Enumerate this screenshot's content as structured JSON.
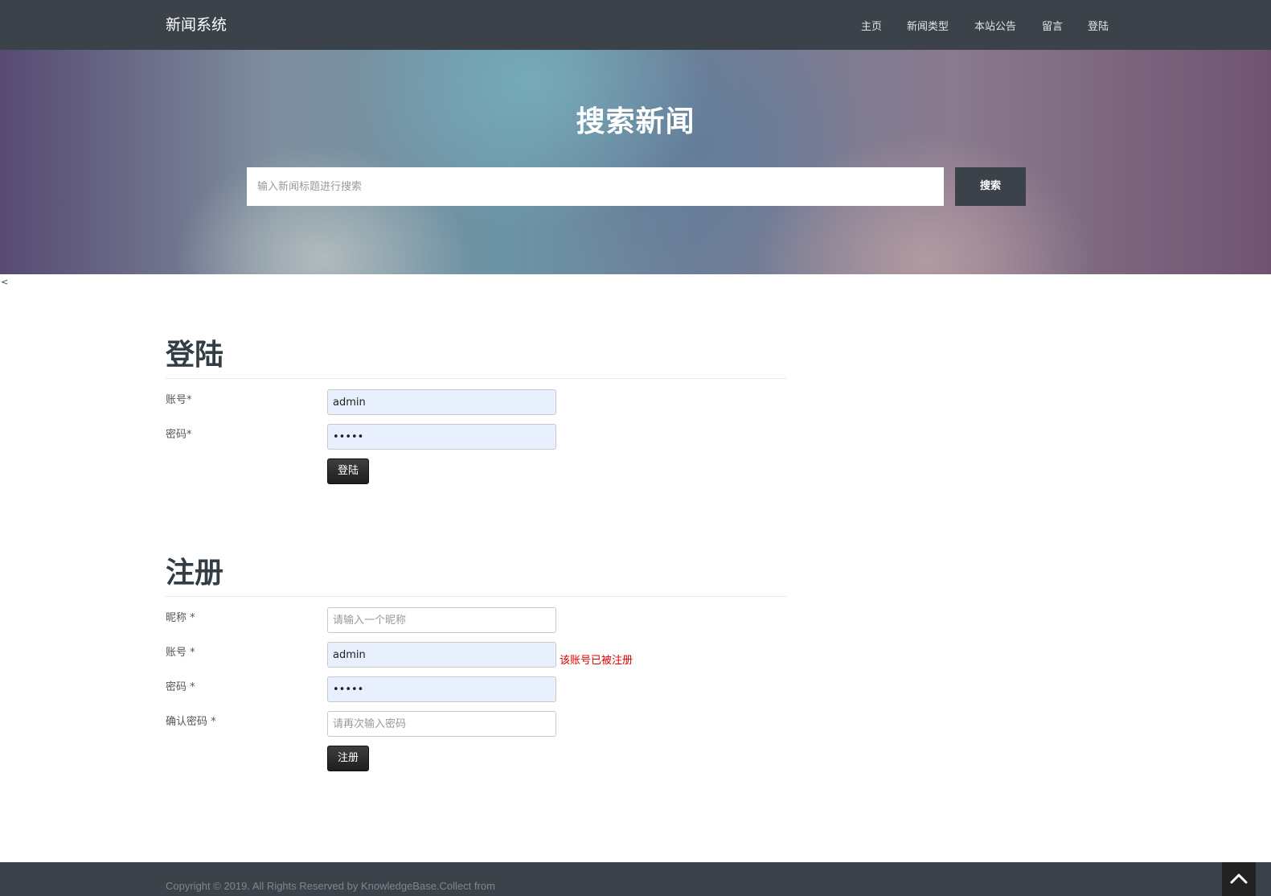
{
  "nav": {
    "brand": "新闻系统",
    "items": [
      {
        "label": "主页"
      },
      {
        "label": "新闻类型"
      },
      {
        "label": "本站公告"
      },
      {
        "label": "留言"
      },
      {
        "label": "登陆"
      }
    ]
  },
  "hero": {
    "title": "搜索新闻",
    "search_placeholder": "输入新闻标题进行搜索",
    "search_button": "搜索"
  },
  "stray_text": "<",
  "login": {
    "title": "登陆",
    "account_label": "账号*",
    "account_value": "admin",
    "password_label": "密码*",
    "password_value": "admin",
    "submit_label": "登陆"
  },
  "register": {
    "title": "注册",
    "nickname_label": "昵称 *",
    "nickname_placeholder": "请输入一个昵称",
    "account_label": "账号 *",
    "account_value": "admin",
    "account_error": "该账号已被注册",
    "password_label": "密码 *",
    "password_value": "admin",
    "confirm_label": "确认密码 *",
    "confirm_placeholder": "请再次输入密码",
    "submit_label": "注册"
  },
  "footer": {
    "copyright": "Copyright © 2019. All Rights Reserved by KnowledgeBase.Collect from"
  },
  "icons": {
    "back_to_top": "chevron-up-icon"
  }
}
